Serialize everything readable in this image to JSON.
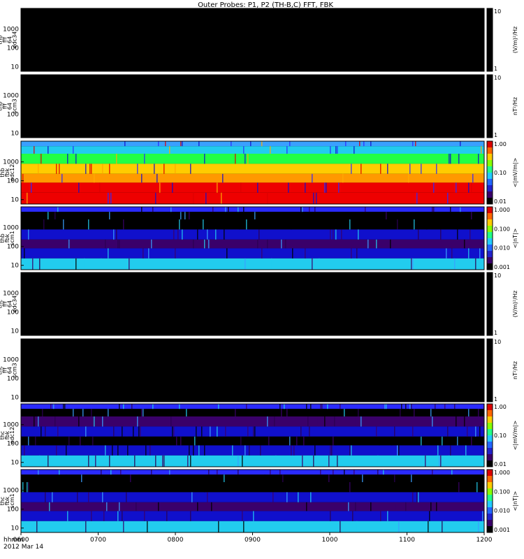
{
  "chart_data": {
    "type": "heatmap",
    "title": "Outer Probes: P1, P2 (TH-B,C) FFT, FBK",
    "x_axis": {
      "ticks": [
        "0600",
        "0700",
        "0800",
        "0900",
        "1000",
        "1100",
        "1200"
      ],
      "range": [
        "0600",
        "1200"
      ],
      "label_line1": "hhmm",
      "label_line2": "2012 Mar 14"
    },
    "panels": [
      {
        "label": [
          "thb",
          "fff",
          "64",
          "edc34"
        ],
        "yticks": [
          "1000",
          "100",
          "10"
        ],
        "cbar_ticks": [
          "10",
          "1"
        ],
        "cbar_label": "(V/m)²/Hz",
        "style": "blank"
      },
      {
        "label": [
          "thb",
          "fff",
          "64",
          "scm3"
        ],
        "yticks": [
          "1000",
          "100",
          "10"
        ],
        "cbar_ticks": [
          "10",
          "1"
        ],
        "cbar_label": "nT²/Hz",
        "style": "blank"
      },
      {
        "label": [
          "thb",
          "fbk",
          "edc12"
        ],
        "yticks": [
          "1000",
          "100",
          "10"
        ],
        "cbar_ticks": [
          "1.00",
          "0.10",
          "0.01"
        ],
        "cbar_label": "<|mV/m|>",
        "style": "rainbow_hot",
        "bands_top_to_bottom": [
          "blue",
          "cyan",
          "green",
          "yellow",
          "orange",
          "red",
          "red"
        ]
      },
      {
        "label": [
          "thb",
          "fbk",
          "scm1"
        ],
        "yticks": [
          "1000",
          "100",
          "10"
        ],
        "cbar_ticks": [
          "1.000",
          "0.100",
          "0.010",
          "0.001"
        ],
        "cbar_label": "<|nT|>",
        "style": "dark",
        "bands_top_to_bottom": [
          "blue",
          "black",
          "black",
          "blue",
          "purple",
          "blue",
          "cyan"
        ]
      },
      {
        "label": [
          "thc",
          "fff",
          "64",
          "edc34"
        ],
        "yticks": [
          "1000",
          "100",
          "10"
        ],
        "cbar_ticks": [
          "10",
          "1"
        ],
        "cbar_label": "(V/m)²/Hz",
        "style": "blank"
      },
      {
        "label": [
          "thc",
          "fff",
          "64",
          "scm3"
        ],
        "yticks": [
          "1000",
          "100",
          "10"
        ],
        "cbar_ticks": [
          "10",
          "1"
        ],
        "cbar_label": "nT²/Hz",
        "style": "blank"
      },
      {
        "label": [
          "thc",
          "fbk",
          "edc12"
        ],
        "yticks": [
          "1000",
          "100",
          "10"
        ],
        "cbar_ticks": [
          "1.00",
          "0.10",
          "0.01"
        ],
        "cbar_label": "<|mV/m|>",
        "style": "sparse",
        "bands_top_to_bottom": [
          "blue",
          "black",
          "purple",
          "blue",
          "black",
          "blue",
          "cyan"
        ]
      },
      {
        "label": [
          "thc",
          "fbk",
          "scm1"
        ],
        "yticks": [
          "1000",
          "100",
          "10"
        ],
        "cbar_ticks": [
          "1.000",
          "0.100",
          "0.010",
          "0.001"
        ],
        "cbar_label": "<|nT|>",
        "style": "dark",
        "bands_top_to_bottom": [
          "blue",
          "black",
          "black",
          "blue",
          "purple",
          "blue",
          "cyan"
        ]
      }
    ],
    "colors": {
      "black": "#000000",
      "purple": "#3a006a",
      "violet": "#2a0052",
      "blue": "#2a2aff",
      "deepblue": "#1010cc",
      "cyan": "#22ccee",
      "lightblue": "#3aa0ff",
      "green": "#22ff44",
      "yellow": "#ffcc00",
      "orange": "#ff9900",
      "red": "#ee0000"
    }
  }
}
